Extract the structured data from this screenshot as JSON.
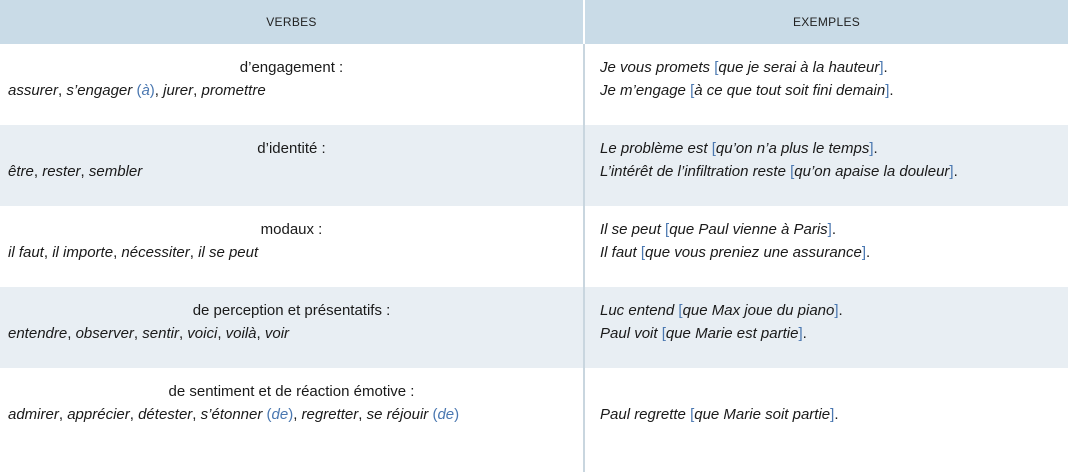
{
  "headers": {
    "verbs": "VERBES",
    "examples": "EXEMPLES"
  },
  "rows": [
    {
      "category": "d’engagement :",
      "verbs": [
        {
          "t": "assurer"
        },
        {
          "p": ", "
        },
        {
          "t": "s’engager "
        },
        {
          "b": "("
        },
        {
          "bt": "à"
        },
        {
          "b": ")"
        },
        {
          "p": ", "
        },
        {
          "t": "jurer"
        },
        {
          "p": ", "
        },
        {
          "t": "promettre"
        }
      ],
      "examples": [
        [
          {
            "t": "Je vous promets "
          },
          {
            "b": "["
          },
          {
            "t": "que je serai à la hauteur"
          },
          {
            "b": "]"
          },
          {
            "p": "."
          }
        ],
        [
          {
            "t": "Je m’engage "
          },
          {
            "b": "["
          },
          {
            "t": "à ce que tout soit fini demain"
          },
          {
            "b": "]"
          },
          {
            "p": "."
          }
        ]
      ]
    },
    {
      "category": "d’identité :",
      "verbs": [
        {
          "t": "être"
        },
        {
          "p": ", "
        },
        {
          "t": "rester"
        },
        {
          "p": ", "
        },
        {
          "t": "sembler"
        }
      ],
      "examples": [
        [
          {
            "t": "Le problème est "
          },
          {
            "b": "["
          },
          {
            "t": "qu’on n’a plus le temps"
          },
          {
            "b": "]"
          },
          {
            "p": "."
          }
        ],
        [
          {
            "t": "L’intérêt de l’infiltration reste "
          },
          {
            "b": "["
          },
          {
            "t": "qu’on apaise la douleur"
          },
          {
            "b": "]"
          },
          {
            "p": "."
          }
        ]
      ]
    },
    {
      "category": "modaux :",
      "verbs": [
        {
          "t": "il faut"
        },
        {
          "p": ", "
        },
        {
          "t": "il importe"
        },
        {
          "p": ", "
        },
        {
          "t": "nécessiter"
        },
        {
          "p": ", "
        },
        {
          "t": "il se peut"
        }
      ],
      "examples": [
        [
          {
            "t": "Il se peut "
          },
          {
            "b": "["
          },
          {
            "t": "que Paul vienne à Paris"
          },
          {
            "b": "]"
          },
          {
            "p": "."
          }
        ],
        [
          {
            "t": "Il faut "
          },
          {
            "b": "["
          },
          {
            "t": "que vous preniez une assurance"
          },
          {
            "b": "]"
          },
          {
            "p": "."
          }
        ]
      ]
    },
    {
      "category": "de perception et présentatifs :",
      "verbs": [
        {
          "t": "entendre"
        },
        {
          "p": ", "
        },
        {
          "t": "observer"
        },
        {
          "p": ", "
        },
        {
          "t": "sentir"
        },
        {
          "p": ", "
        },
        {
          "t": "voici"
        },
        {
          "p": ", "
        },
        {
          "t": "voilà"
        },
        {
          "p": ", "
        },
        {
          "t": "voir"
        }
      ],
      "examples": [
        [
          {
            "t": "Luc entend "
          },
          {
            "b": "["
          },
          {
            "t": "que Max joue du piano"
          },
          {
            "b": "]"
          },
          {
            "p": "."
          }
        ],
        [
          {
            "t": "Paul voit "
          },
          {
            "b": "["
          },
          {
            "t": "que Marie est partie"
          },
          {
            "b": "]"
          },
          {
            "p": "."
          }
        ]
      ]
    },
    {
      "category": "de sentiment et de réaction émotive :",
      "verbs": [
        {
          "t": "admirer"
        },
        {
          "p": ", "
        },
        {
          "t": "apprécier"
        },
        {
          "p": ", "
        },
        {
          "t": "détester"
        },
        {
          "p": ", "
        },
        {
          "t": "s’étonner "
        },
        {
          "b": "("
        },
        {
          "bt": "de"
        },
        {
          "b": ")"
        },
        {
          "p": ", "
        },
        {
          "t": "regretter"
        },
        {
          "p": ", "
        },
        {
          "t": "se réjouir "
        },
        {
          "b": "("
        },
        {
          "bt": "de"
        },
        {
          "b": ")"
        }
      ],
      "examples": [
        [
          {
            "t": "Paul regrette "
          },
          {
            "b": "["
          },
          {
            "t": "que Marie soit partie"
          },
          {
            "b": "]"
          },
          {
            "p": "."
          }
        ]
      ]
    }
  ]
}
